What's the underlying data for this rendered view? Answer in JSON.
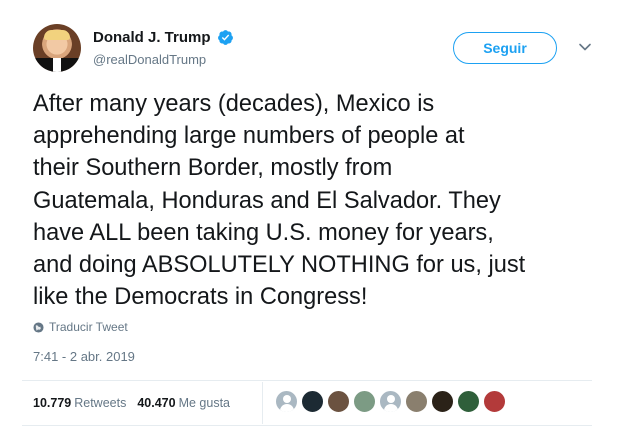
{
  "author": {
    "display_name": "Donald J. Trump",
    "handle": "@realDonaldTrump",
    "verified": true
  },
  "follow_button_label": "Seguir",
  "tweet": {
    "text": "After many years (decades), Mexico is\napprehending large numbers of people at\ntheir Southern Border, mostly from\nGuatemala, Honduras and El Salvador. They\nhave ALL been taking U.S. money for years,\nand doing ABSOLUTELY NOTHING for us, just\nlike the Democrats in Congress!",
    "translate_label": "Traducir Tweet",
    "timestamp": "7:41 - 2 abr. 2019"
  },
  "stats": {
    "retweets_count": "10.779",
    "retweets_label": "Retweets",
    "likes_count": "40.470",
    "likes_label": "Me gusta"
  },
  "likers": [
    {
      "icon": "default-avatar-icon",
      "color": "#aab8c2"
    },
    {
      "icon": "user-avatar-icon",
      "color": "#1c2a33"
    },
    {
      "icon": "user-avatar-icon",
      "color": "#6b5240"
    },
    {
      "icon": "user-avatar-icon",
      "color": "#7c9b84"
    },
    {
      "icon": "default-avatar-icon",
      "color": "#aab8c2"
    },
    {
      "icon": "user-avatar-icon",
      "color": "#8a7f6e"
    },
    {
      "icon": "user-avatar-icon",
      "color": "#2b2218"
    },
    {
      "icon": "user-avatar-icon",
      "color": "#2f5f3a"
    },
    {
      "icon": "user-avatar-icon",
      "color": "#b33a3a"
    }
  ],
  "colors": {
    "accent": "#1da1f2",
    "text": "#14171a",
    "secondary_text": "#657786",
    "divider": "#e6ecf0"
  }
}
